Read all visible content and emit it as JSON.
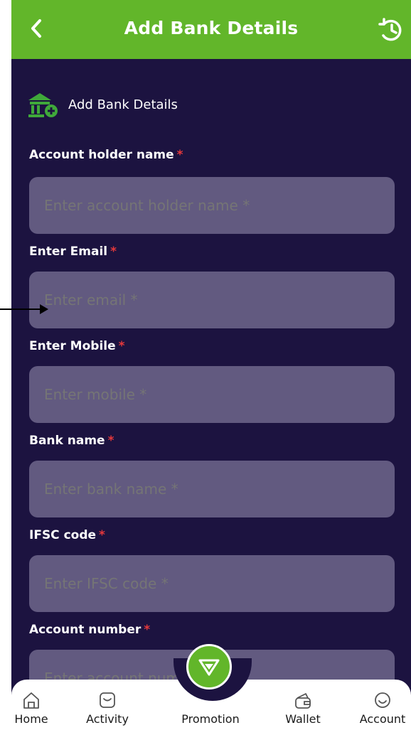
{
  "header": {
    "title": "Add Bank Details"
  },
  "section": {
    "title": "Add Bank Details"
  },
  "fields": [
    {
      "label": "Account holder name",
      "required": "*",
      "placeholder": "Enter account holder name *"
    },
    {
      "label": "Enter Email",
      "required": "*",
      "placeholder": "Enter email *"
    },
    {
      "label": "Enter Mobile",
      "required": "*",
      "placeholder": "Enter mobile *"
    },
    {
      "label": "Bank name",
      "required": "*",
      "placeholder": "Enter bank name *"
    },
    {
      "label": "IFSC code",
      "required": "*",
      "placeholder": "Enter IFSC code *"
    },
    {
      "label": "Account number",
      "required": "*",
      "placeholder": "Enter account number *"
    }
  ],
  "nav": {
    "home": "Home",
    "activity": "Activity",
    "promotion": "Promotion",
    "wallet": "Wallet",
    "account": "Account"
  },
  "colors": {
    "header": "#62b62a",
    "background": "#1c1340",
    "input": "#625a80",
    "required": "#e5383b"
  },
  "icons": {
    "back": "chevron-left-icon",
    "history": "history-icon",
    "bank": "bank-add-icon",
    "promotion": "diamond-icon"
  }
}
